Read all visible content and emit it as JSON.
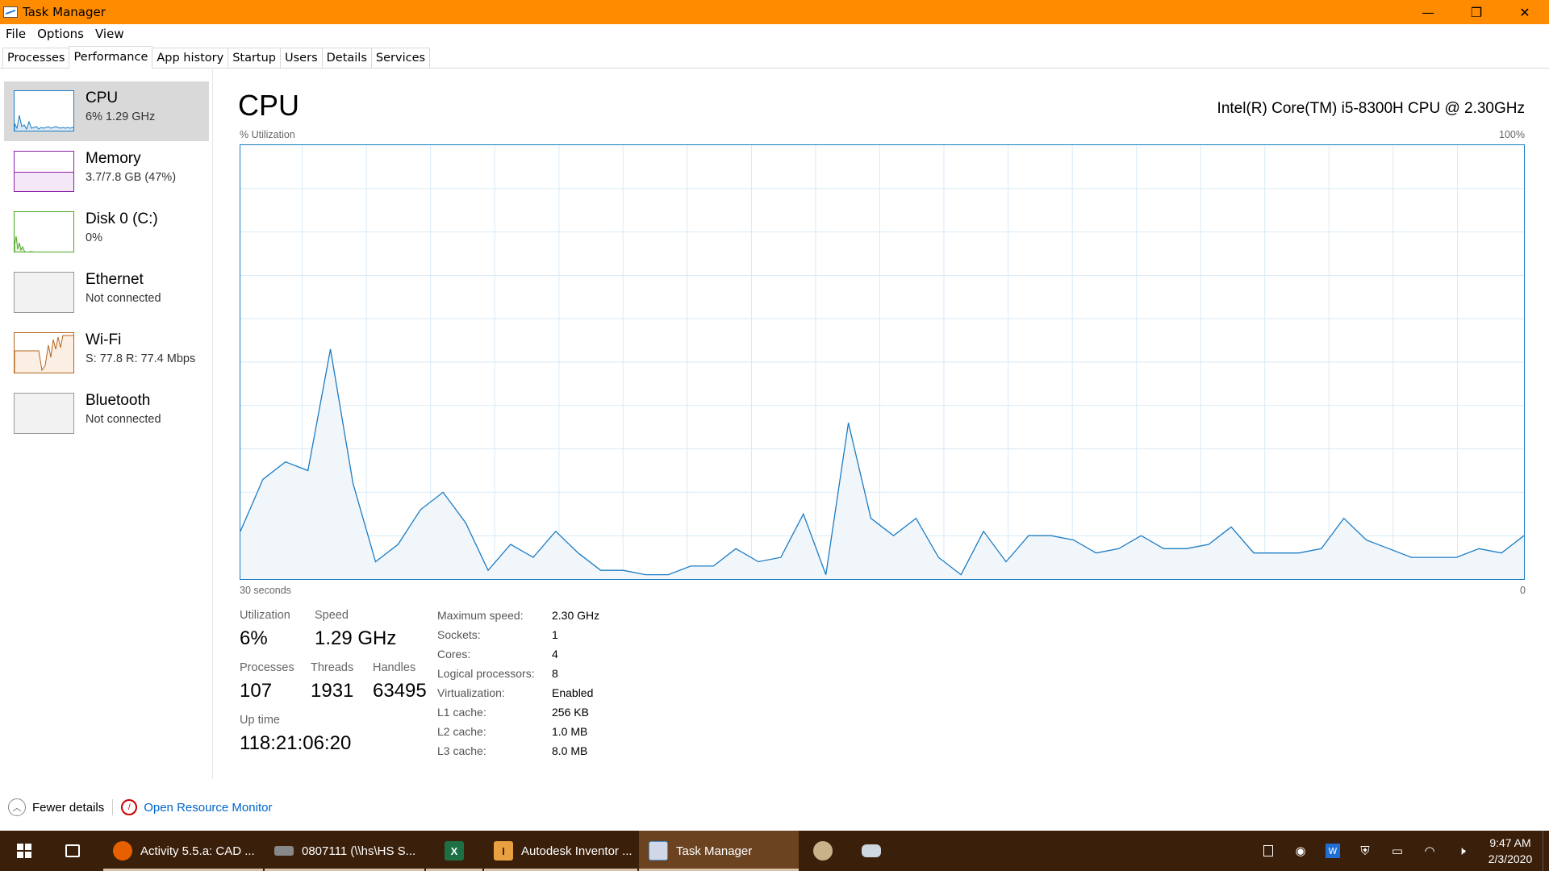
{
  "window": {
    "title": "Task Manager",
    "minimize": "—",
    "restore": "❐",
    "close": "✕"
  },
  "menu": [
    "File",
    "Options",
    "View"
  ],
  "tabs": [
    "Processes",
    "Performance",
    "App history",
    "Startup",
    "Users",
    "Details",
    "Services"
  ],
  "active_tab": "Performance",
  "sidebar": [
    {
      "name": "CPU",
      "value": "6%  1.29 GHz",
      "color": "#1b7cc4",
      "selected": true
    },
    {
      "name": "Memory",
      "value": "3.7/7.8 GB (47%)",
      "color": "#8b1fa9"
    },
    {
      "name": "Disk 0 (C:)",
      "value": "0%",
      "color": "#4ca61f"
    },
    {
      "name": "Ethernet",
      "value": "Not connected",
      "color": "#999999"
    },
    {
      "name": "Wi-Fi",
      "value": "S: 77.8  R: 77.4 Mbps",
      "color": "#b5651d"
    },
    {
      "name": "Bluetooth",
      "value": "Not connected",
      "color": "#999999"
    }
  ],
  "main": {
    "title": "CPU",
    "cpu_model": "Intel(R) Core(TM) i5-8300H CPU @ 2.30GHz",
    "graph_label": "% Utilization",
    "graph_max": "100%",
    "graph_time": "30 seconds",
    "graph_zero": "0"
  },
  "chart_data": {
    "type": "area",
    "ylabel": "% Utilization",
    "ylim": [
      0,
      100
    ],
    "xlim": [
      60,
      0
    ],
    "color": "#1b7cc4",
    "fill": "#f1f6fa",
    "grid": true,
    "values": [
      11,
      23,
      27,
      25,
      53,
      22,
      4,
      8,
      16,
      20,
      13,
      2,
      8,
      5,
      11,
      6,
      2,
      2,
      1,
      1,
      3,
      3,
      7,
      4,
      5,
      15,
      1,
      36,
      14,
      10,
      14,
      5,
      1,
      11,
      4,
      10,
      10,
      9,
      6,
      7,
      10,
      7,
      7,
      8,
      12,
      6,
      6,
      6,
      7,
      14,
      9,
      7,
      5,
      5,
      5,
      7,
      6,
      10
    ]
  },
  "stats": {
    "utilization_label": "Utilization",
    "utilization": "6%",
    "speed_label": "Speed",
    "speed": "1.29 GHz",
    "processes_label": "Processes",
    "processes": "107",
    "threads_label": "Threads",
    "threads": "1931",
    "handles_label": "Handles",
    "handles": "63495",
    "uptime_label": "Up time",
    "uptime": "118:21:06:20"
  },
  "specs": [
    {
      "key": "Maximum speed:",
      "val": "2.30 GHz"
    },
    {
      "key": "Sockets:",
      "val": "1"
    },
    {
      "key": "Cores:",
      "val": "4"
    },
    {
      "key": "Logical processors:",
      "val": "8"
    },
    {
      "key": "Virtualization:",
      "val": "Enabled"
    },
    {
      "key": "L1 cache:",
      "val": "256 KB"
    },
    {
      "key": "L2 cache:",
      "val": "1.0 MB"
    },
    {
      "key": "L3 cache:",
      "val": "8.0 MB"
    }
  ],
  "footer": {
    "fewer_details": "Fewer details",
    "open_monitor": "Open Resource Monitor"
  },
  "taskbar": {
    "apps": [
      {
        "label": "Activity 5.5.a: CAD ...",
        "icon": "firefox-icon",
        "color": "#e66000"
      },
      {
        "label": "0807111 (\\\\hs\\HS S...",
        "icon": "drive-icon",
        "color": "#888888"
      },
      {
        "label": "",
        "icon": "excel-icon",
        "color": "#1d7044"
      },
      {
        "label": "Autodesk Inventor ...",
        "icon": "inventor-icon",
        "color": "#e8a040"
      },
      {
        "label": "Task Manager",
        "icon": "task-manager-icon",
        "color": "#4a90d9"
      }
    ],
    "time": "9:47 AM",
    "date": "2/3/2020"
  }
}
